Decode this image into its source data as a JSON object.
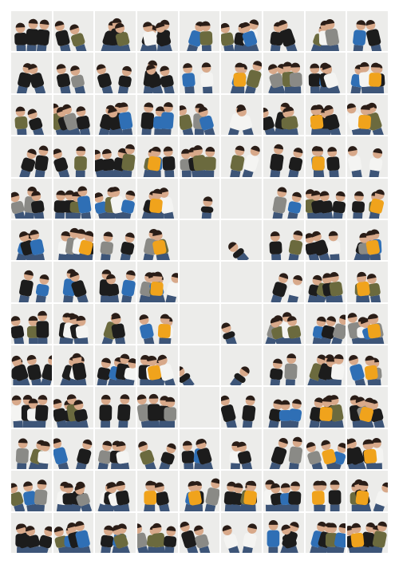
{
  "image": {
    "description_kind": "photographic contact sheet",
    "background_color": "#ffffff",
    "frame_background_color": "#ededed",
    "grid": {
      "columns": 9,
      "rows": 13
    },
    "palette": {
      "black_shirt": "#1c1c1c",
      "orange_shirt": "#f0a31c",
      "blue_shirt": "#2f6fb5",
      "olive_shirt": "#6b6a3e",
      "grey_shirt": "#8a8a86",
      "white_shirt": "#f4f4f2",
      "skin": "#d8a98a",
      "hair": "#2a1d17",
      "jeans": "#3d5578",
      "wall": "#ececea"
    },
    "frames": [
      "C",
      "C",
      "C",
      "C",
      "C",
      "C",
      "C",
      "C",
      "C",
      "C",
      "C",
      "C",
      "C",
      "C",
      "O",
      "C",
      "C",
      "O",
      "C",
      "C",
      "C",
      "C",
      "C",
      "C",
      "C",
      "O",
      "O",
      "C",
      "C",
      "C",
      "O",
      "C",
      "C",
      "C",
      "O",
      "C",
      "C",
      "C",
      "C",
      "O",
      "W",
      "E",
      "C",
      "C",
      "O",
      "C",
      "O",
      "C",
      "O",
      "W",
      "W",
      "C",
      "C",
      "O",
      "C",
      "C",
      "C",
      "O",
      "W",
      "W",
      "C",
      "C",
      "O",
      "C",
      "C",
      "C",
      "O",
      "W",
      "W",
      "C",
      "C",
      "O",
      "C",
      "C",
      "C",
      "O",
      "W",
      "W",
      "C",
      "C",
      "O",
      "C",
      "C",
      "C",
      "C",
      "W",
      "C",
      "C",
      "O",
      "O",
      "C",
      "C",
      "C",
      "C",
      "C",
      "C",
      "C",
      "O",
      "O",
      "C",
      "C",
      "C",
      "O",
      "O",
      "O",
      "C",
      "O",
      "O",
      "C",
      "C",
      "C",
      "C",
      "C",
      "C",
      "C",
      "C",
      "O"
    ]
  }
}
